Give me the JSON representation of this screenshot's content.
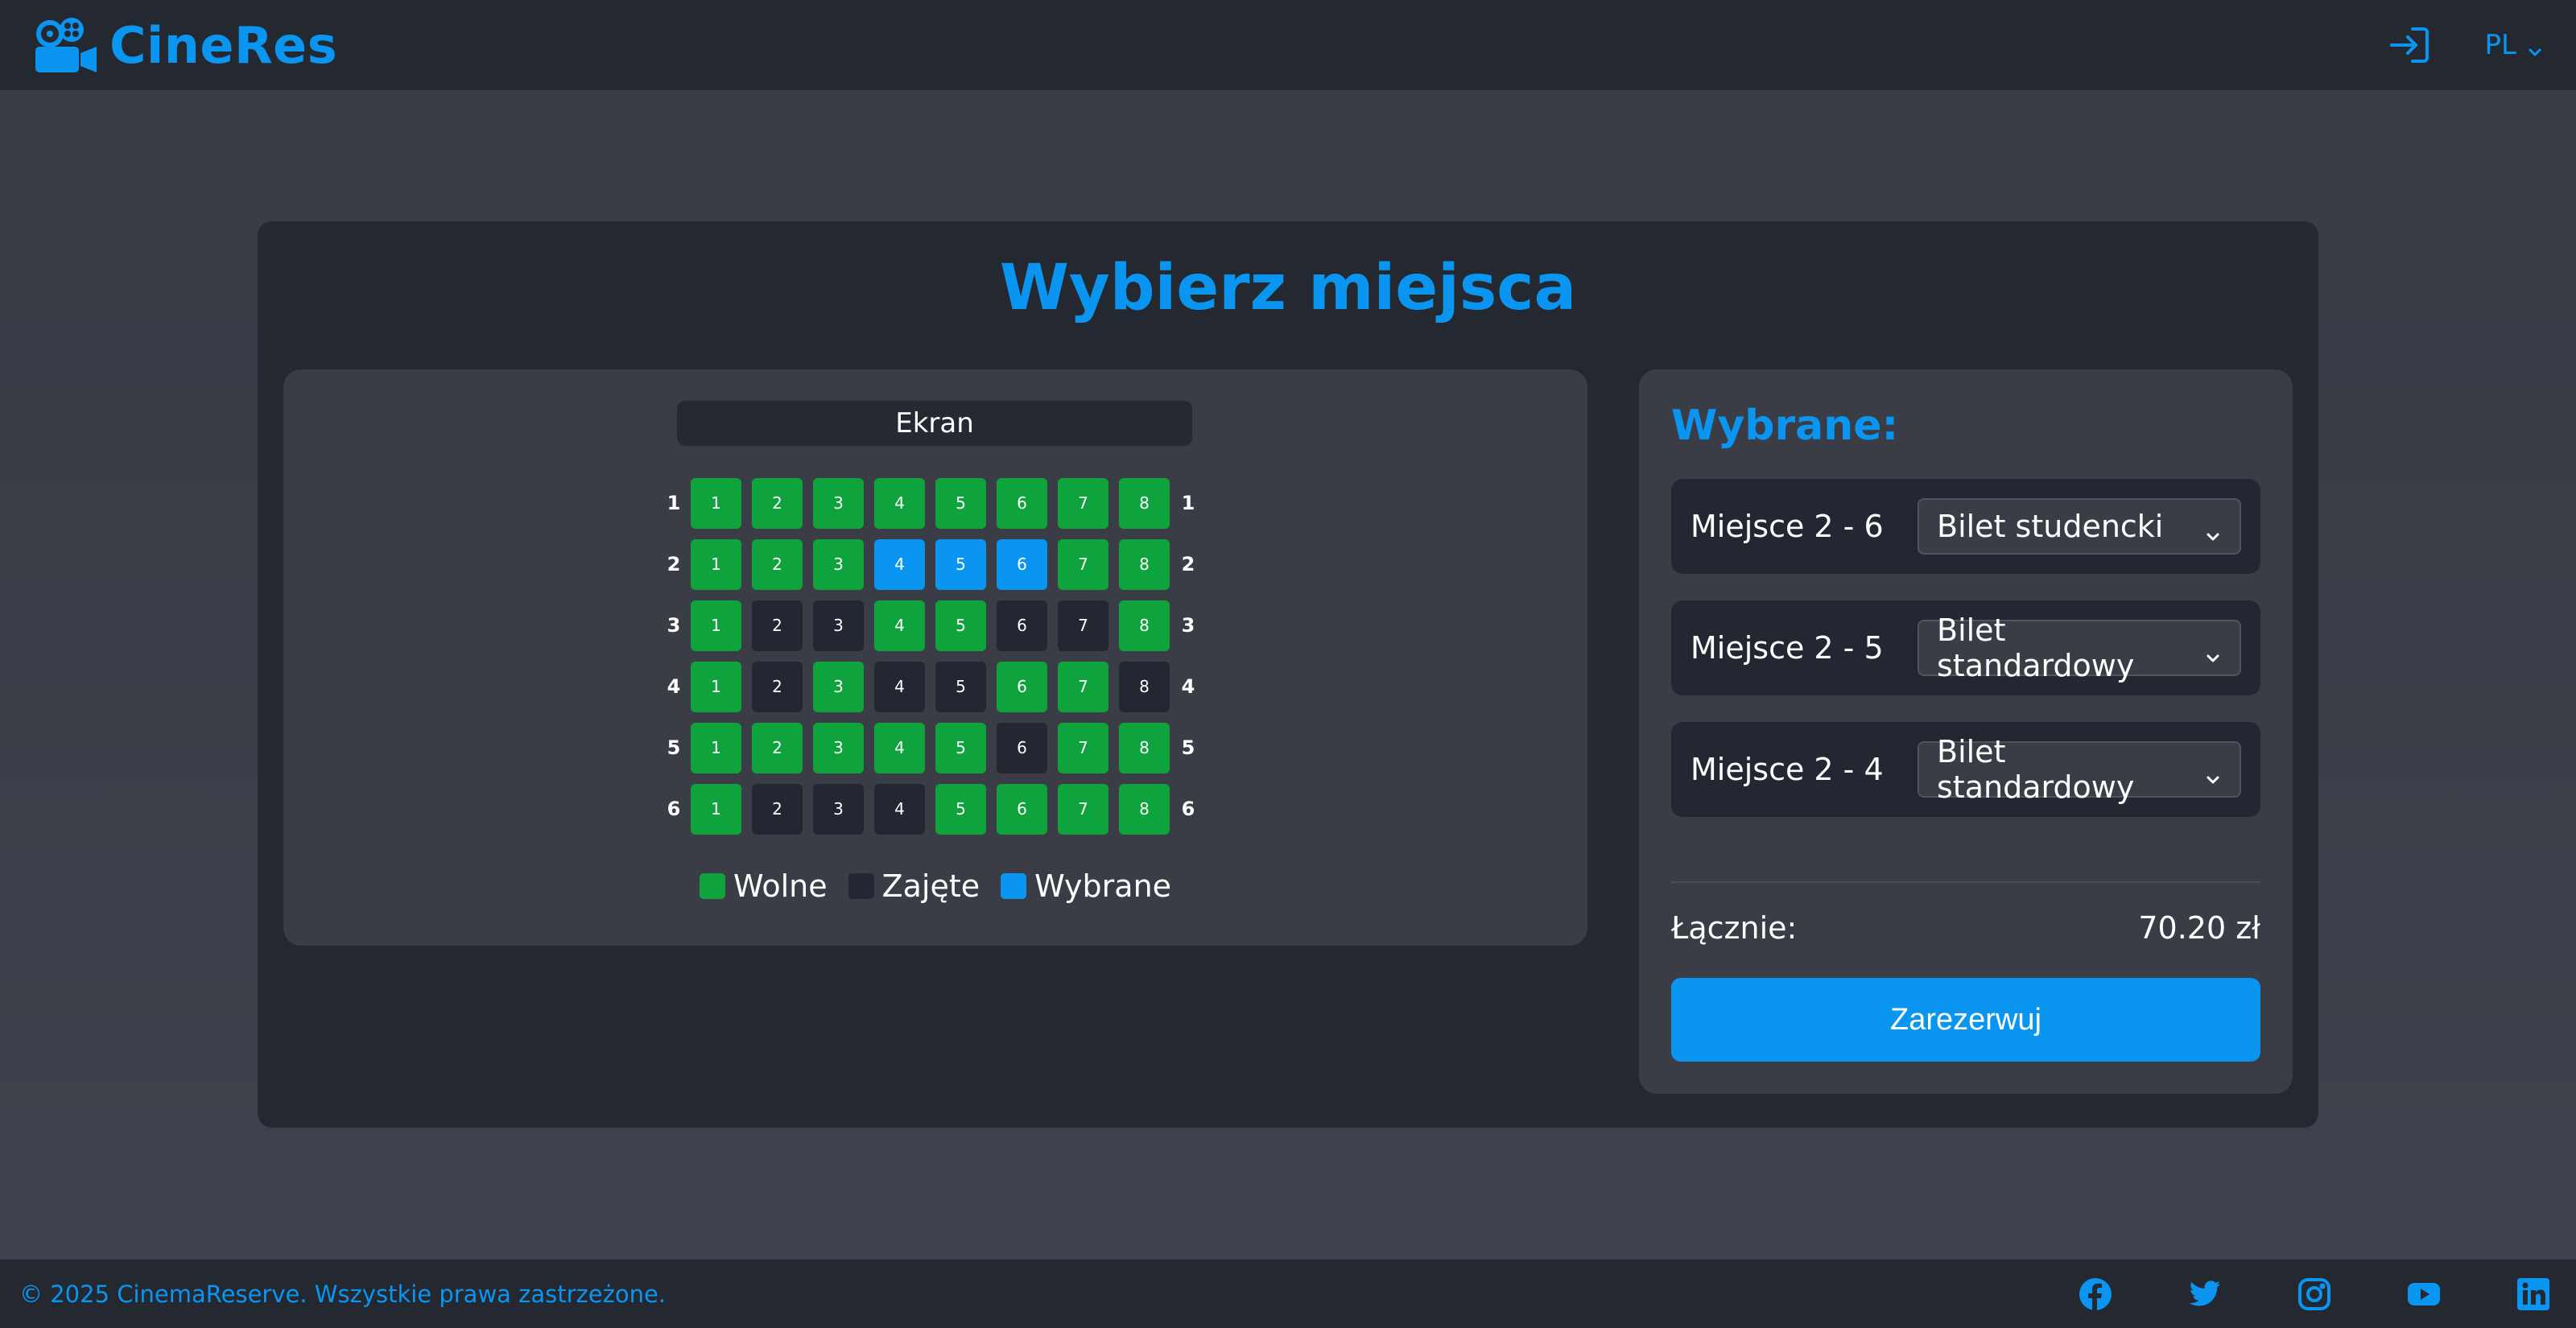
{
  "header": {
    "brand_name": "CineRes",
    "brand_icon": "film-camera-icon",
    "login_icon": "sign-in-icon",
    "language": "PL"
  },
  "main": {
    "title": "Wybierz miejsca",
    "screen_label": "Ekran",
    "rows": [
      {
        "label": "1",
        "seats": [
          {
            "number": "1",
            "status": "free"
          },
          {
            "number": "2",
            "status": "free"
          },
          {
            "number": "3",
            "status": "free"
          },
          {
            "number": "4",
            "status": "free"
          },
          {
            "number": "5",
            "status": "free"
          },
          {
            "number": "6",
            "status": "free"
          },
          {
            "number": "7",
            "status": "free"
          },
          {
            "number": "8",
            "status": "free"
          }
        ]
      },
      {
        "label": "2",
        "seats": [
          {
            "number": "1",
            "status": "free"
          },
          {
            "number": "2",
            "status": "free"
          },
          {
            "number": "3",
            "status": "free"
          },
          {
            "number": "4",
            "status": "selected"
          },
          {
            "number": "5",
            "status": "selected"
          },
          {
            "number": "6",
            "status": "selected"
          },
          {
            "number": "7",
            "status": "free"
          },
          {
            "number": "8",
            "status": "free"
          }
        ]
      },
      {
        "label": "3",
        "seats": [
          {
            "number": "1",
            "status": "free"
          },
          {
            "number": "2",
            "status": "taken"
          },
          {
            "number": "3",
            "status": "taken"
          },
          {
            "number": "4",
            "status": "free"
          },
          {
            "number": "5",
            "status": "free"
          },
          {
            "number": "6",
            "status": "taken"
          },
          {
            "number": "7",
            "status": "taken"
          },
          {
            "number": "8",
            "status": "free"
          }
        ]
      },
      {
        "label": "4",
        "seats": [
          {
            "number": "1",
            "status": "free"
          },
          {
            "number": "2",
            "status": "taken"
          },
          {
            "number": "3",
            "status": "free"
          },
          {
            "number": "4",
            "status": "taken"
          },
          {
            "number": "5",
            "status": "taken"
          },
          {
            "number": "6",
            "status": "free"
          },
          {
            "number": "7",
            "status": "free"
          },
          {
            "number": "8",
            "status": "taken"
          }
        ]
      },
      {
        "label": "5",
        "seats": [
          {
            "number": "1",
            "status": "free"
          },
          {
            "number": "2",
            "status": "free"
          },
          {
            "number": "3",
            "status": "free"
          },
          {
            "number": "4",
            "status": "free"
          },
          {
            "number": "5",
            "status": "free"
          },
          {
            "number": "6",
            "status": "taken"
          },
          {
            "number": "7",
            "status": "free"
          },
          {
            "number": "8",
            "status": "free"
          }
        ]
      },
      {
        "label": "6",
        "seats": [
          {
            "number": "1",
            "status": "free"
          },
          {
            "number": "2",
            "status": "taken"
          },
          {
            "number": "3",
            "status": "taken"
          },
          {
            "number": "4",
            "status": "taken"
          },
          {
            "number": "5",
            "status": "free"
          },
          {
            "number": "6",
            "status": "free"
          },
          {
            "number": "7",
            "status": "free"
          },
          {
            "number": "8",
            "status": "free"
          }
        ]
      }
    ],
    "legend": {
      "free": "Wolne",
      "taken": "Zajęte",
      "selected": "Wybrane"
    }
  },
  "selection": {
    "title": "Wybrane:",
    "tickets": [
      {
        "label": "Miejsce 2 - 6",
        "type": "Bilet studencki"
      },
      {
        "label": "Miejsce 2 - 5",
        "type": "Bilet standardowy"
      },
      {
        "label": "Miejsce 2 - 4",
        "type": "Bilet standardowy"
      }
    ],
    "total_label": "Łącznie:",
    "total_value": "70.20 zł",
    "reserve_label": "Zarezerwuj"
  },
  "footer": {
    "copyright": "© 2025 CinemaReserve. Wszystkie prawa zastrzeżone.",
    "socials": [
      "facebook-icon",
      "twitter-icon",
      "instagram-icon",
      "youtube-icon",
      "linkedin-icon"
    ]
  },
  "colors": {
    "accent": "#0a96f0",
    "free": "#0ea33c",
    "taken": "#232731",
    "selected": "#0a96f0",
    "background": "#3a3d46",
    "header": "#242830"
  }
}
